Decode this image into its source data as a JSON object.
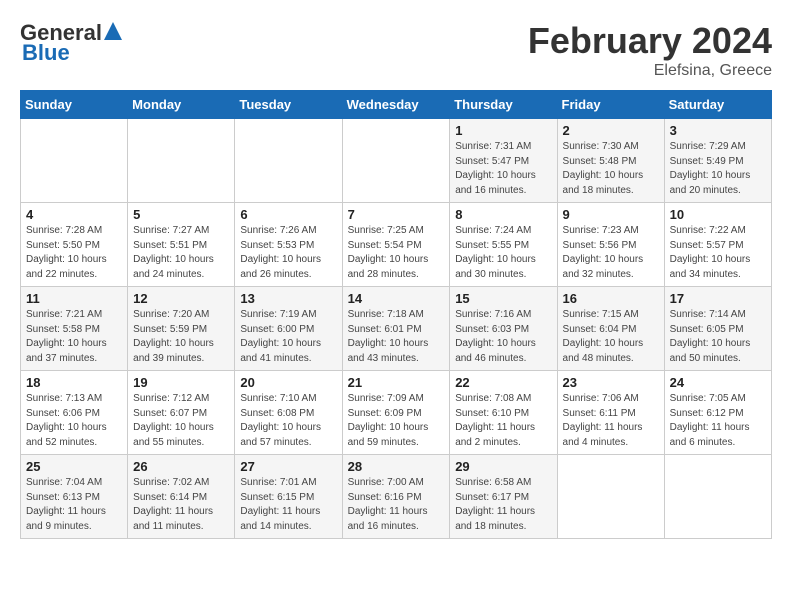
{
  "header": {
    "logo_line1": "General",
    "logo_line2": "Blue",
    "title": "February 2024",
    "subtitle": "Elefsina, Greece"
  },
  "weekdays": [
    "Sunday",
    "Monday",
    "Tuesday",
    "Wednesday",
    "Thursday",
    "Friday",
    "Saturday"
  ],
  "weeks": [
    [
      {
        "day": "",
        "info": ""
      },
      {
        "day": "",
        "info": ""
      },
      {
        "day": "",
        "info": ""
      },
      {
        "day": "",
        "info": ""
      },
      {
        "day": "1",
        "info": "Sunrise: 7:31 AM\nSunset: 5:47 PM\nDaylight: 10 hours\nand 16 minutes."
      },
      {
        "day": "2",
        "info": "Sunrise: 7:30 AM\nSunset: 5:48 PM\nDaylight: 10 hours\nand 18 minutes."
      },
      {
        "day": "3",
        "info": "Sunrise: 7:29 AM\nSunset: 5:49 PM\nDaylight: 10 hours\nand 20 minutes."
      }
    ],
    [
      {
        "day": "4",
        "info": "Sunrise: 7:28 AM\nSunset: 5:50 PM\nDaylight: 10 hours\nand 22 minutes."
      },
      {
        "day": "5",
        "info": "Sunrise: 7:27 AM\nSunset: 5:51 PM\nDaylight: 10 hours\nand 24 minutes."
      },
      {
        "day": "6",
        "info": "Sunrise: 7:26 AM\nSunset: 5:53 PM\nDaylight: 10 hours\nand 26 minutes."
      },
      {
        "day": "7",
        "info": "Sunrise: 7:25 AM\nSunset: 5:54 PM\nDaylight: 10 hours\nand 28 minutes."
      },
      {
        "day": "8",
        "info": "Sunrise: 7:24 AM\nSunset: 5:55 PM\nDaylight: 10 hours\nand 30 minutes."
      },
      {
        "day": "9",
        "info": "Sunrise: 7:23 AM\nSunset: 5:56 PM\nDaylight: 10 hours\nand 32 minutes."
      },
      {
        "day": "10",
        "info": "Sunrise: 7:22 AM\nSunset: 5:57 PM\nDaylight: 10 hours\nand 34 minutes."
      }
    ],
    [
      {
        "day": "11",
        "info": "Sunrise: 7:21 AM\nSunset: 5:58 PM\nDaylight: 10 hours\nand 37 minutes."
      },
      {
        "day": "12",
        "info": "Sunrise: 7:20 AM\nSunset: 5:59 PM\nDaylight: 10 hours\nand 39 minutes."
      },
      {
        "day": "13",
        "info": "Sunrise: 7:19 AM\nSunset: 6:00 PM\nDaylight: 10 hours\nand 41 minutes."
      },
      {
        "day": "14",
        "info": "Sunrise: 7:18 AM\nSunset: 6:01 PM\nDaylight: 10 hours\nand 43 minutes."
      },
      {
        "day": "15",
        "info": "Sunrise: 7:16 AM\nSunset: 6:03 PM\nDaylight: 10 hours\nand 46 minutes."
      },
      {
        "day": "16",
        "info": "Sunrise: 7:15 AM\nSunset: 6:04 PM\nDaylight: 10 hours\nand 48 minutes."
      },
      {
        "day": "17",
        "info": "Sunrise: 7:14 AM\nSunset: 6:05 PM\nDaylight: 10 hours\nand 50 minutes."
      }
    ],
    [
      {
        "day": "18",
        "info": "Sunrise: 7:13 AM\nSunset: 6:06 PM\nDaylight: 10 hours\nand 52 minutes."
      },
      {
        "day": "19",
        "info": "Sunrise: 7:12 AM\nSunset: 6:07 PM\nDaylight: 10 hours\nand 55 minutes."
      },
      {
        "day": "20",
        "info": "Sunrise: 7:10 AM\nSunset: 6:08 PM\nDaylight: 10 hours\nand 57 minutes."
      },
      {
        "day": "21",
        "info": "Sunrise: 7:09 AM\nSunset: 6:09 PM\nDaylight: 10 hours\nand 59 minutes."
      },
      {
        "day": "22",
        "info": "Sunrise: 7:08 AM\nSunset: 6:10 PM\nDaylight: 11 hours\nand 2 minutes."
      },
      {
        "day": "23",
        "info": "Sunrise: 7:06 AM\nSunset: 6:11 PM\nDaylight: 11 hours\nand 4 minutes."
      },
      {
        "day": "24",
        "info": "Sunrise: 7:05 AM\nSunset: 6:12 PM\nDaylight: 11 hours\nand 6 minutes."
      }
    ],
    [
      {
        "day": "25",
        "info": "Sunrise: 7:04 AM\nSunset: 6:13 PM\nDaylight: 11 hours\nand 9 minutes."
      },
      {
        "day": "26",
        "info": "Sunrise: 7:02 AM\nSunset: 6:14 PM\nDaylight: 11 hours\nand 11 minutes."
      },
      {
        "day": "27",
        "info": "Sunrise: 7:01 AM\nSunset: 6:15 PM\nDaylight: 11 hours\nand 14 minutes."
      },
      {
        "day": "28",
        "info": "Sunrise: 7:00 AM\nSunset: 6:16 PM\nDaylight: 11 hours\nand 16 minutes."
      },
      {
        "day": "29",
        "info": "Sunrise: 6:58 AM\nSunset: 6:17 PM\nDaylight: 11 hours\nand 18 minutes."
      },
      {
        "day": "",
        "info": ""
      },
      {
        "day": "",
        "info": ""
      }
    ]
  ]
}
